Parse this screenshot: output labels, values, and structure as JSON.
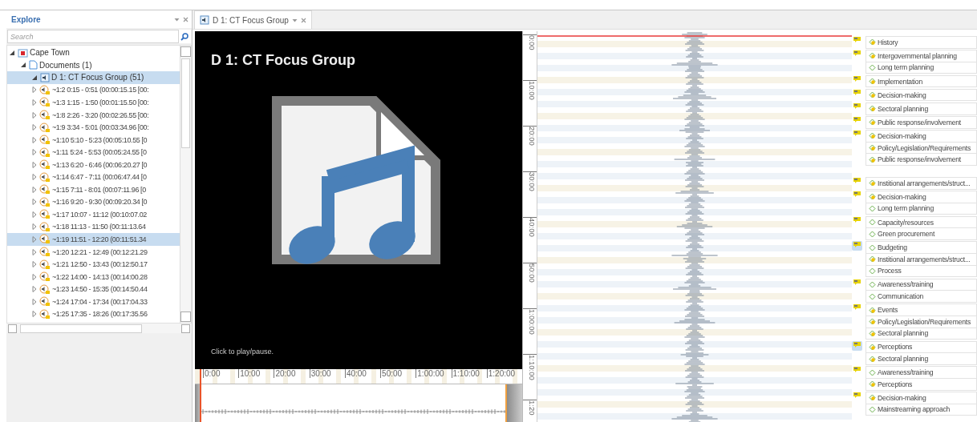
{
  "explorer": {
    "title": "Explore",
    "search": {
      "placeholder": "Search"
    },
    "tree": [
      {
        "label": "Cape Town",
        "kind": "project",
        "expanded": true,
        "selected": false,
        "children": [
          {
            "label": "Documents (1)",
            "kind": "folder",
            "expanded": true,
            "selected": false,
            "children": [
              {
                "label": "D 1: CT Focus Group (51)",
                "kind": "document",
                "expanded": true,
                "selected": true,
                "children": [
                  {
                    "label": "~1:2 0:15 - 0:51 (00:00:15.15 [00:",
                    "kind": "quote",
                    "expanded": false,
                    "selected": false
                  },
                  {
                    "label": "~1:3 1:15 - 1:50 (00:01:15.50 [00:",
                    "kind": "quote",
                    "expanded": false,
                    "selected": false
                  },
                  {
                    "label": "~1:8 2:26 - 3:20 (00:02:26.55 [00:",
                    "kind": "quote",
                    "expanded": false,
                    "selected": false
                  },
                  {
                    "label": "~1:9 3:34 - 5:01 (00:03:34.96 [00:",
                    "kind": "quote",
                    "expanded": false,
                    "selected": false
                  },
                  {
                    "label": "~1:10 5:10 - 5:23 (00:05:10.55 [0",
                    "kind": "quote",
                    "expanded": false,
                    "selected": false
                  },
                  {
                    "label": "~1:11 5:24 - 5:53 (00:05:24.55 [0",
                    "kind": "quote",
                    "expanded": false,
                    "selected": false
                  },
                  {
                    "label": "~1:13 6:20 - 6:46 (00:06:20.27 [0",
                    "kind": "quote",
                    "expanded": false,
                    "selected": false
                  },
                  {
                    "label": "~1:14 6:47 - 7:11 (00:06:47.44 [0",
                    "kind": "quote",
                    "expanded": false,
                    "selected": false
                  },
                  {
                    "label": "~1:15 7:11 - 8:01 (00:07:11.96 [0",
                    "kind": "quote",
                    "expanded": false,
                    "selected": false
                  },
                  {
                    "label": "~1:16 9:20 - 9:30 (00:09:20.34 [0",
                    "kind": "quote",
                    "expanded": false,
                    "selected": false
                  },
                  {
                    "label": "~1:17 10:07 - 11:12 (00:10:07.02",
                    "kind": "quote",
                    "expanded": false,
                    "selected": false
                  },
                  {
                    "label": "~1:18 11:13 - 11:50 (00:11:13.64",
                    "kind": "quote",
                    "expanded": false,
                    "selected": false
                  },
                  {
                    "label": "~1:19 11:51 - 12:20 (00:11:51.34",
                    "kind": "quote",
                    "expanded": false,
                    "selected": true
                  },
                  {
                    "label": "~1:20 12:21 - 12:49 (00:12:21.29",
                    "kind": "quote",
                    "expanded": false,
                    "selected": false
                  },
                  {
                    "label": "~1:21 12:50 - 13:43 (00:12:50.17",
                    "kind": "quote",
                    "expanded": false,
                    "selected": false
                  },
                  {
                    "label": "~1:22 14:00 - 14:13 (00:14:00.28",
                    "kind": "quote",
                    "expanded": false,
                    "selected": false
                  },
                  {
                    "label": "~1:23 14:50 - 15:35 (00:14:50.44",
                    "kind": "quote",
                    "expanded": false,
                    "selected": false
                  },
                  {
                    "label": "~1:24 17:04 - 17:34 (00:17:04.33",
                    "kind": "quote",
                    "expanded": false,
                    "selected": false
                  },
                  {
                    "label": "~1:25 17:35 - 18:26 (00:17:35.56",
                    "kind": "quote",
                    "expanded": false,
                    "selected": false
                  }
                ]
              }
            ]
          }
        ]
      }
    ]
  },
  "tabs": [
    {
      "label": "D 1: CT Focus Group",
      "selected": true
    }
  ],
  "player": {
    "title": "D 1: CT Focus Group",
    "hint": "Click to play/pause.",
    "ruler": [
      "0:00",
      "10:00",
      "20:00",
      "30:00",
      "40:00",
      "50:00",
      "1:00:00",
      "1:10:00",
      "1:20:00"
    ]
  },
  "margin_ruler": [
    "0:00",
    "10:00",
    "20:00",
    "30:00",
    "40:00",
    "50:00",
    "1:00:00",
    "1:10:00",
    "1:20"
  ],
  "quotations": [
    {
      "selected": false,
      "codes": [
        {
          "label": "History",
          "kind": "linked"
        }
      ]
    },
    {
      "selected": false,
      "codes": [
        {
          "label": "Intergovernmental planning",
          "kind": "linked"
        },
        {
          "label": "Long term planning",
          "kind": "plain"
        }
      ]
    },
    {
      "selected": false,
      "codes": [
        {
          "label": "Implementation",
          "kind": "linked"
        }
      ]
    },
    {
      "selected": false,
      "codes": [
        {
          "label": "Decision-making",
          "kind": "linked"
        }
      ]
    },
    {
      "selected": false,
      "codes": [
        {
          "label": "Sectoral planning",
          "kind": "linked"
        }
      ]
    },
    {
      "selected": false,
      "codes": [
        {
          "label": "Public response/involvement",
          "kind": "linked"
        }
      ]
    },
    {
      "selected": false,
      "codes": [
        {
          "label": "Decision-making",
          "kind": "linked"
        },
        {
          "label": "Policy/Legislation/Requirements",
          "kind": "linked"
        },
        {
          "label": "Public response/involvement",
          "kind": "linked"
        }
      ]
    },
    {
      "selected": false,
      "gap": true,
      "codes": [
        {
          "label": "Institional arrangements/struct...",
          "kind": "linked"
        }
      ]
    },
    {
      "selected": false,
      "codes": [
        {
          "label": "Decision-making",
          "kind": "linked"
        },
        {
          "label": "Long term planning",
          "kind": "plain"
        }
      ]
    },
    {
      "selected": false,
      "codes": [
        {
          "label": "Capacity/resources",
          "kind": "plain"
        },
        {
          "label": "Green procurement",
          "kind": "plain"
        }
      ]
    },
    {
      "selected": true,
      "codes": [
        {
          "label": "Budgeting",
          "kind": "plain"
        },
        {
          "label": "Institional arrangements/struct...",
          "kind": "linked"
        },
        {
          "label": "Process",
          "kind": "plain"
        }
      ]
    },
    {
      "selected": false,
      "codes": [
        {
          "label": "Awareness/training",
          "kind": "plain"
        },
        {
          "label": "Communication",
          "kind": "plain"
        }
      ]
    },
    {
      "selected": false,
      "codes": [
        {
          "label": "Events",
          "kind": "linked"
        },
        {
          "label": "Policy/Legislation/Requirements",
          "kind": "linked"
        },
        {
          "label": "Sectoral planning",
          "kind": "linked"
        }
      ]
    },
    {
      "selected": true,
      "codes": [
        {
          "label": "Perceptions",
          "kind": "linked"
        },
        {
          "label": "Sectoral planning",
          "kind": "linked"
        }
      ]
    },
    {
      "selected": false,
      "codes": [
        {
          "label": "Awareness/training",
          "kind": "plain"
        },
        {
          "label": "Perceptions",
          "kind": "linked"
        }
      ]
    },
    {
      "selected": false,
      "codes": [
        {
          "label": "Decision-making",
          "kind": "linked"
        },
        {
          "label": "Mainstreaming approach",
          "kind": "plain"
        }
      ]
    }
  ]
}
